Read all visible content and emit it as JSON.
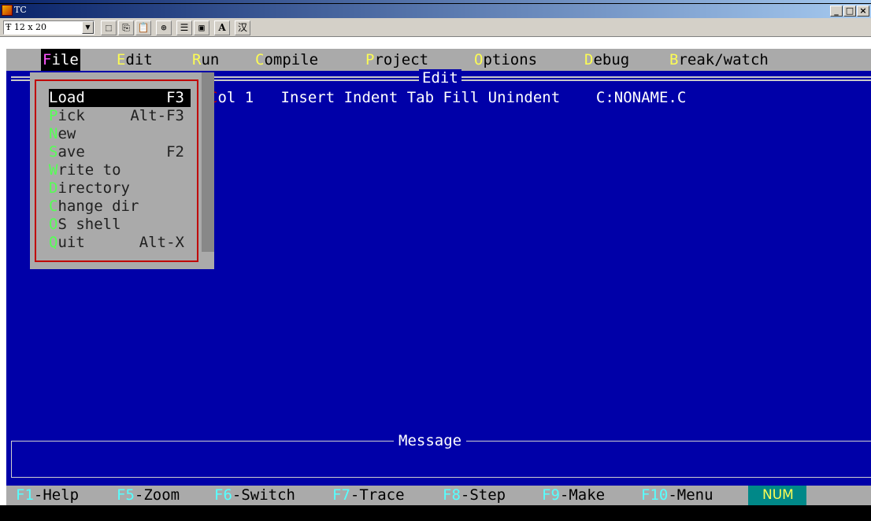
{
  "window": {
    "title": "TC"
  },
  "window_buttons": [
    "_",
    "□",
    "×"
  ],
  "toolbar": {
    "font_size": "12 x 20"
  },
  "menubar": {
    "items": [
      {
        "hot": "F",
        "rest": "ile"
      },
      {
        "hot": "E",
        "rest": "dit"
      },
      {
        "hot": "R",
        "rest": "un"
      },
      {
        "hot": "C",
        "rest": "ompile"
      },
      {
        "hot": "P",
        "rest": "roject"
      },
      {
        "hot": "O",
        "rest": "ptions"
      },
      {
        "hot": "D",
        "rest": "ebug"
      },
      {
        "hot": "B",
        "rest": "reak/watch"
      }
    ]
  },
  "editor": {
    "title": "Edit",
    "status": {
      "col_letter": "C",
      "col_rest": "ol 1",
      "modes": "Insert Indent Tab Fill Unindent",
      "file": "C:NONAME.C"
    }
  },
  "file_menu": {
    "items": [
      {
        "hot": "L",
        "rest": "oad",
        "shortcut": "F3"
      },
      {
        "hot": "P",
        "rest": "ick",
        "shortcut": "Alt-F3"
      },
      {
        "hot": "N",
        "rest": "ew",
        "shortcut": ""
      },
      {
        "hot": "S",
        "rest": "ave",
        "shortcut": "F2"
      },
      {
        "hot": "W",
        "rest": "rite to",
        "shortcut": ""
      },
      {
        "hot": "D",
        "rest": "irectory",
        "shortcut": ""
      },
      {
        "hot": "C",
        "rest": "hange dir",
        "shortcut": ""
      },
      {
        "hot": "O",
        "rest": "S shell",
        "shortcut": ""
      },
      {
        "hot": "Q",
        "rest": "uit",
        "shortcut": "Alt-X"
      }
    ]
  },
  "message": {
    "title": "Message"
  },
  "function_bar": {
    "keys": [
      {
        "key": "F1",
        "label": "-Help"
      },
      {
        "key": "F5",
        "label": "-Zoom"
      },
      {
        "key": "F6",
        "label": "-Switch"
      },
      {
        "key": "F7",
        "label": "-Trace"
      },
      {
        "key": "F8",
        "label": "-Step"
      },
      {
        "key": "F9",
        "label": "-Make"
      },
      {
        "key": "F10",
        "label": "-Menu"
      }
    ],
    "num": "NUM"
  },
  "colors": {
    "screen": "#0000a8",
    "menu_gray": "#aaaaaa",
    "hotkey_yellow": "#fcfc54",
    "hotkey_green": "#55ff55",
    "fkey_cyan": "#55ffff",
    "highlight_red": "#c00000"
  }
}
